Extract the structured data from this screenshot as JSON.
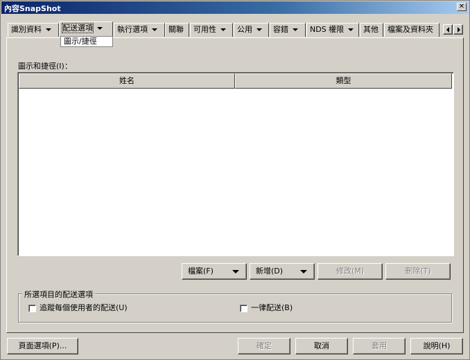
{
  "window": {
    "title": "內容SnapShot",
    "close_label": "✕"
  },
  "tabs": [
    {
      "label": "識別資料",
      "has_menu": true
    },
    {
      "label": "配送選項",
      "has_menu": true
    },
    {
      "label": "執行選項",
      "has_menu": true
    },
    {
      "label": "關聯",
      "has_menu": false
    },
    {
      "label": "可用性",
      "has_menu": true
    },
    {
      "label": "公用",
      "has_menu": true
    },
    {
      "label": "容錯",
      "has_menu": true
    },
    {
      "label": "NDS 權限",
      "has_menu": true
    },
    {
      "label": "其他",
      "has_menu": false
    },
    {
      "label": "檔案及資料夾",
      "has_menu": false
    }
  ],
  "dropdown": {
    "selected": "圖示/捷徑"
  },
  "icons_label": "圖示和捷徑(I)：",
  "list": {
    "columns": [
      "姓名",
      "類型"
    ],
    "rows": []
  },
  "list_buttons": {
    "file": "檔案(F)",
    "new": "新增(D)",
    "modify": "修改(M)",
    "delete": "刪除(T)"
  },
  "group": {
    "title": "所選項目的配送選項",
    "track_label": "追蹤每個使用者的配送(U)",
    "always_label": "一律配送(B)"
  },
  "footer": {
    "page_options": "頁面選項(P)...",
    "ok": "確定",
    "cancel": "取消",
    "apply": "套用",
    "help": "說明(H)"
  }
}
